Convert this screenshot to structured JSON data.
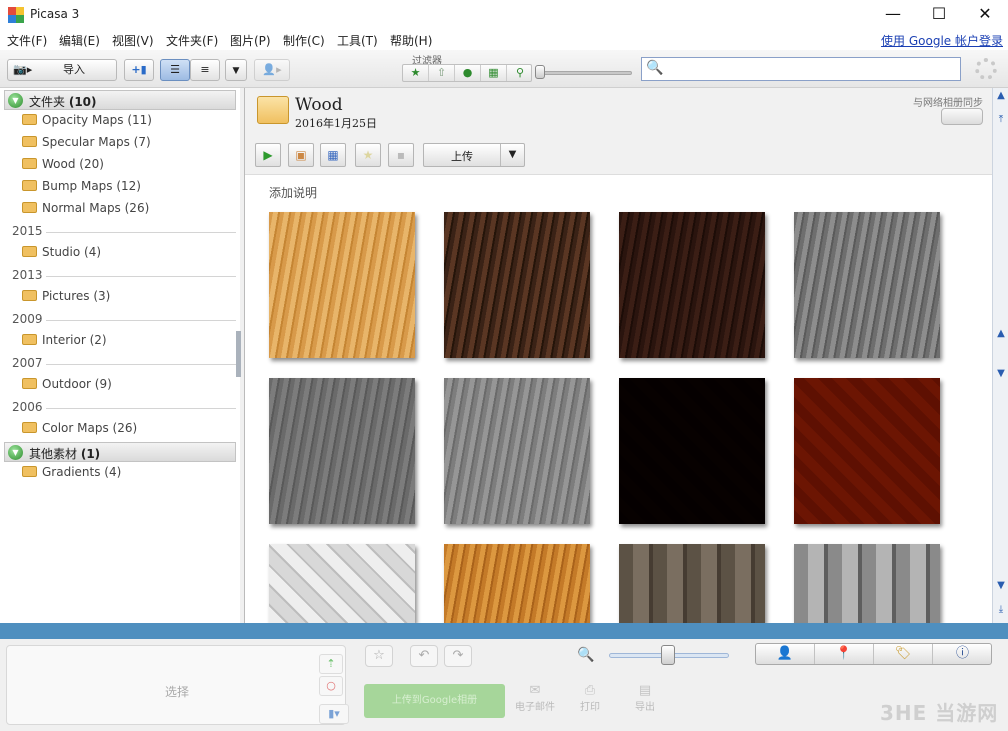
{
  "window": {
    "title": "Picasa 3",
    "minimize": "—",
    "maximize": "☐",
    "close": "✕"
  },
  "menu": {
    "items": [
      "文件(F)",
      "编辑(E)",
      "视图(V)",
      "文件夹(F)",
      "图片(P)",
      "制作(C)",
      "工具(T)",
      "帮助(H)"
    ],
    "login": "使用 Google 帐户登录"
  },
  "toolbar": {
    "import_label": "导入",
    "filter_label": "过滤器",
    "search_value": ""
  },
  "sidebar": {
    "folders_header": {
      "name": "文件夹",
      "count": "(10)"
    },
    "top_folders": [
      {
        "label": "Opacity Maps (11)"
      },
      {
        "label": "Specular Maps (7)"
      },
      {
        "label": "Wood (20)"
      },
      {
        "label": "Bump Maps (12)"
      },
      {
        "label": "Normal Maps (26)"
      }
    ],
    "years": [
      {
        "year": "2015",
        "folder": "Studio (4)"
      },
      {
        "year": "2013",
        "folder": "Pictures (3)"
      },
      {
        "year": "2009",
        "folder": "Interior (2)"
      },
      {
        "year": "2007",
        "folder": "Outdoor (9)"
      },
      {
        "year": "2006",
        "folder": "Color Maps (26)"
      }
    ],
    "other_header": {
      "name": "其他素材",
      "count": "(1)"
    },
    "other_folders": [
      {
        "label": "Gradients (4)"
      }
    ]
  },
  "album": {
    "title": "Wood",
    "date": "2016年1月25日",
    "sync_label": "与网络相册同步",
    "upload_label": "上传",
    "caption": "添加说明"
  },
  "thumbnails": [
    {
      "name": "light-maple",
      "colors": [
        "#d89a4a",
        "#e8b56a",
        "#c58533"
      ]
    },
    {
      "name": "dark-walnut",
      "colors": [
        "#3a2216",
        "#5a3623",
        "#241409"
      ]
    },
    {
      "name": "dark-ebony",
      "colors": [
        "#2a140e",
        "#3b1e15",
        "#1c0c07"
      ]
    },
    {
      "name": "grey-grain",
      "colors": [
        "#6e6e6e",
        "#8d8d8d",
        "#5a5a5a"
      ]
    },
    {
      "name": "grey-fine",
      "colors": [
        "#6a6a6a",
        "#7c7c7c",
        "#595959"
      ]
    },
    {
      "name": "grey-knot",
      "colors": [
        "#7d7d7d",
        "#969696",
        "#6a6a6a"
      ]
    },
    {
      "name": "dark-parquet",
      "colors": [
        "#2a0f0a",
        "#3a1810",
        "#1e0805"
      ]
    },
    {
      "name": "red-herringbone",
      "colors": [
        "#a84a1c",
        "#c2602a",
        "#8e3812"
      ]
    },
    {
      "name": "white-basket",
      "colors": [
        "#d8d8d8",
        "#eeeeee",
        "#bdbdbd"
      ]
    },
    {
      "name": "golden-oak",
      "colors": [
        "#c47a28",
        "#dc9840",
        "#a9621a"
      ]
    },
    {
      "name": "weathered-planks",
      "colors": [
        "#5c5245",
        "#7a6e60",
        "#463c32"
      ]
    },
    {
      "name": "grey-planks",
      "colors": [
        "#8a8a8a",
        "#b4b4b4",
        "#5e5e5e"
      ]
    }
  ],
  "tray": {
    "select_label": "选择",
    "share_label": "上传到Google相册",
    "email_label": "电子邮件",
    "print_label": "打印",
    "export_label": "导出"
  },
  "watermark": "3HE 当游网"
}
